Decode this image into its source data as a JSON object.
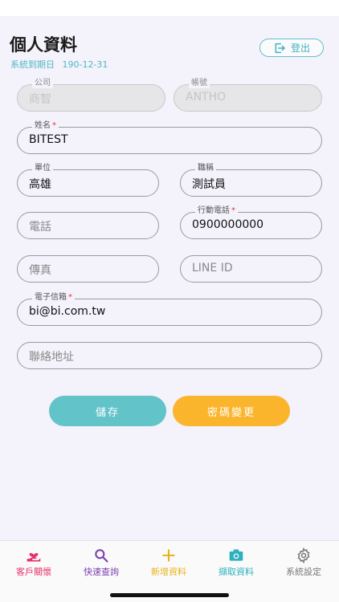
{
  "header": {
    "title": "個人資料",
    "expiry_label": "系統到期日",
    "expiry_value": "190-12-31",
    "logout_label": "登出"
  },
  "form": {
    "company": {
      "label": "公司",
      "value": "商智"
    },
    "account": {
      "label": "帳號",
      "value": "ANTHO"
    },
    "name": {
      "label": "姓名",
      "value": "BITEST",
      "required": "*"
    },
    "unit": {
      "label": "單位",
      "value": "高雄"
    },
    "job_title": {
      "label": "職稱",
      "value": "測試員"
    },
    "phone": {
      "placeholder": "電話"
    },
    "mobile": {
      "label": "行動電話",
      "value": "0900000000",
      "required": "*"
    },
    "fax": {
      "placeholder": "傳真"
    },
    "line_id": {
      "placeholder": "LINE ID"
    },
    "email": {
      "label": "電子信箱",
      "value": "bi@bi.com.tw",
      "required": "*"
    },
    "address": {
      "placeholder": "聯絡地址"
    }
  },
  "actions": {
    "save_label": "儲存",
    "change_password_label": "密碼變更"
  },
  "tabbar": {
    "items": [
      {
        "label": "客戶關懷",
        "icon": "heart-hand-icon",
        "color": "#e8306a"
      },
      {
        "label": "快速查詢",
        "icon": "search-icon",
        "color": "#7b3fae"
      },
      {
        "label": "新增資料",
        "icon": "plus-icon",
        "color": "#e9b21a"
      },
      {
        "label": "擷取資料",
        "icon": "camera-icon",
        "color": "#2fb1bd"
      },
      {
        "label": "系統設定",
        "icon": "gear-icon",
        "color": "#777777"
      }
    ]
  },
  "colors": {
    "accent_teal": "#62c3c9",
    "accent_orange": "#fbb52d",
    "required": "#e53935"
  }
}
